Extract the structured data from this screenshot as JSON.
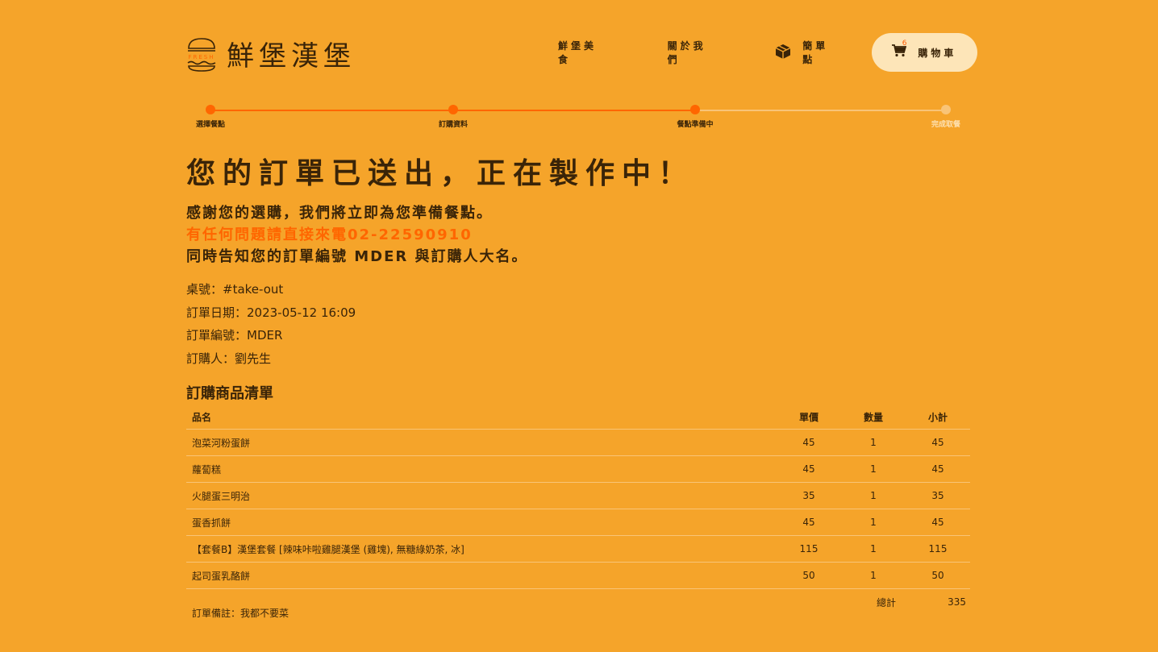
{
  "brand": {
    "name": "鮮堡漢堡",
    "logo_tag": "FRESH"
  },
  "nav": {
    "food": "鮮堡美食",
    "about": "關於我們",
    "quick_order": "簡單點",
    "cart": "購物車",
    "cart_count": "6"
  },
  "progress": {
    "steps": [
      {
        "label": "選擇餐點",
        "done": true
      },
      {
        "label": "訂購資料",
        "done": true
      },
      {
        "label": "餐點準備中",
        "done": true
      },
      {
        "label": "完成取餐",
        "done": false
      }
    ]
  },
  "headline": "您的訂單已送出，正在製作中！",
  "messages": {
    "line1": "感謝您的選購，我們將立即為您準備餐點。",
    "line2": "有任何問題請直接來電02-22590910",
    "line3": "同時告知您的訂單編號 MDER 與訂購人大名。"
  },
  "order_info": {
    "table": "桌號：#take-out",
    "date": "訂單日期：2023-05-12 16:09",
    "number": "訂單編號：MDER",
    "customer": "訂購人：劉先生"
  },
  "items_title": "訂購商品清單",
  "table": {
    "headers": {
      "name": "品名",
      "price": "單價",
      "qty": "數量",
      "subtotal": "小計"
    },
    "rows": [
      {
        "name": "泡菜河粉蛋餅",
        "price": "45",
        "qty": "1",
        "subtotal": "45"
      },
      {
        "name": "蘿蔔糕",
        "price": "45",
        "qty": "1",
        "subtotal": "45"
      },
      {
        "name": "火腿蛋三明治",
        "price": "35",
        "qty": "1",
        "subtotal": "35"
      },
      {
        "name": "蛋香抓餅",
        "price": "45",
        "qty": "1",
        "subtotal": "45"
      },
      {
        "name": "【套餐B】漢堡套餐 [辣味咔啦雞腿漢堡 (雞塊), 無糖綠奶茶, 冰]",
        "price": "115",
        "qty": "1",
        "subtotal": "115"
      },
      {
        "name": "起司蛋乳酪餅",
        "price": "50",
        "qty": "1",
        "subtotal": "50"
      }
    ],
    "total_label": "總計",
    "total_value": "335"
  },
  "note": "訂單備註：我都不要菜",
  "colors": {
    "background": "#F5A42A",
    "accent": "#FF6600",
    "text": "#3A2408",
    "cart_bg": "#FDE5B8"
  }
}
